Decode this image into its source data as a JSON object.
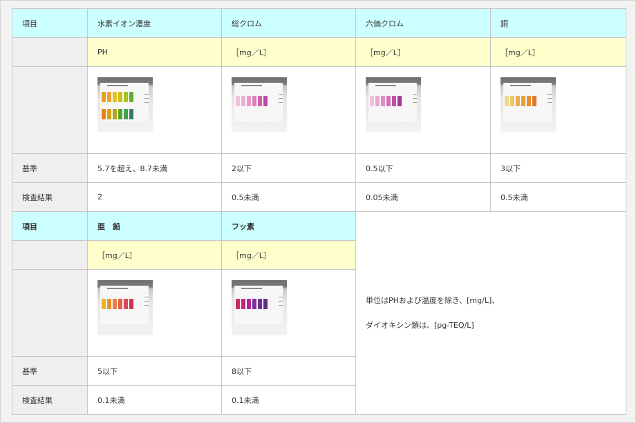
{
  "table1": {
    "headers": [
      "項目",
      "水素イオン濃度",
      "総クロム",
      "六価クロム",
      "銅"
    ],
    "units": [
      "",
      "PH",
      "［mg／L］",
      "［mg／L］",
      "［mg／L］"
    ],
    "standard_label": "基準",
    "standards": [
      "5.7を超え、8.7未満",
      "2以下",
      "0.5以下",
      "3以下"
    ],
    "result_label": "検査結果",
    "results": [
      "2",
      "0.5未満",
      "0.05未満",
      "0.5未満"
    ]
  },
  "table2": {
    "headers": [
      "項目",
      "亜　鉛",
      "フッ素"
    ],
    "units": [
      "",
      "［mg／L］",
      "［mg／L］"
    ],
    "standard_label": "基準",
    "standards": [
      "5以下",
      "8以下"
    ],
    "result_label": "検査結果",
    "results": [
      "0.1未満",
      "0.1未満"
    ]
  },
  "note": {
    "line1": "単位はPHおよび温度を除き、[mg/L]、",
    "line2": "ダイオキシン類は、[pg-TEQ/L]"
  },
  "photos": {
    "ph": {
      "rows": [
        [
          "#e8a020",
          "#f0a030",
          "#e8c020",
          "#c8c020",
          "#a8c020",
          "#60b030"
        ],
        [
          "#e88010",
          "#d8a010",
          "#b0a818",
          "#58a030",
          "#40a050",
          "#308060"
        ]
      ]
    },
    "total_chromium": {
      "rows": [
        [
          "#f2c4dc",
          "#eeb0d4",
          "#e69ac8",
          "#dc80bc",
          "#d060b0",
          "#c048a4"
        ]
      ]
    },
    "hexavalent_chromium": {
      "rows": [
        [
          "#f0c0dc",
          "#e8a8d0",
          "#dc90c4",
          "#d070b8",
          "#c050a8",
          "#a83898"
        ]
      ]
    },
    "copper": {
      "rows": [
        [
          "#f0d888",
          "#ecc868",
          "#e8b050",
          "#e8a040",
          "#e89030",
          "#e07828"
        ]
      ]
    },
    "zinc": {
      "rows": [
        [
          "#f0b020",
          "#e89030",
          "#e88040",
          "#e06050",
          "#d84858",
          "#d03050"
        ]
      ]
    },
    "fluoride": {
      "rows": [
        [
          "#d02868",
          "#c02880",
          "#a82c98",
          "#7e3098",
          "#6c3090",
          "#5c3088"
        ]
      ]
    }
  }
}
